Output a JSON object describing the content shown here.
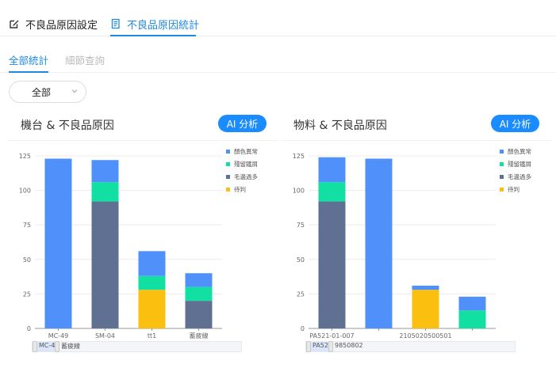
{
  "top_tabs": [
    {
      "label": "不良品原因設定",
      "icon": "edit-icon",
      "active": false
    },
    {
      "label": "不良品原因統計",
      "icon": "document-icon",
      "active": true
    }
  ],
  "sub_tabs": [
    {
      "label": "全部統計",
      "active": true
    },
    {
      "label": "細節查詢",
      "active": false
    }
  ],
  "filter": {
    "selected": "全部"
  },
  "panels": [
    {
      "title": "機台 & 不良品原因",
      "ai_button": "AI 分析",
      "slider": {
        "left_label": "MC-4",
        "right_label": "蓄疲線"
      }
    },
    {
      "title": "物料 & 不良品原因",
      "ai_button": "AI 分析",
      "slider": {
        "left_label": "PA52",
        "right_label": "9850802"
      }
    }
  ],
  "colors": {
    "accent": "#1e88e5",
    "ai_button": "#1a8cff"
  },
  "chart_data": [
    {
      "type": "bar",
      "stacked": true,
      "categories": [
        "MC-49",
        "SM-04",
        "tt1",
        "蓄疲線"
      ],
      "series": [
        {
          "name": "毛邊過多",
          "color": "#5f7093",
          "values": [
            0,
            92,
            0,
            20
          ]
        },
        {
          "name": "待判",
          "color": "#fbbf0f",
          "values": [
            0,
            0,
            28,
            0
          ]
        },
        {
          "name": "殘留鐵屑",
          "color": "#12e0a3",
          "values": [
            0,
            14,
            10,
            10
          ]
        },
        {
          "name": "顏色異常",
          "color": "#5090fa",
          "values": [
            123,
            16,
            18,
            10
          ]
        }
      ],
      "legend": [
        "顏色異常",
        "殘留鐵屑",
        "毛邊過多",
        "待判"
      ],
      "yticks": [
        0,
        25,
        50,
        75,
        100,
        125
      ],
      "ylim": [
        0,
        125
      ],
      "legend_position": "top-right"
    },
    {
      "type": "bar",
      "stacked": true,
      "categories": [
        "PA521-01-007",
        "",
        "2105020500501",
        ""
      ],
      "series": [
        {
          "name": "毛邊過多",
          "color": "#5f7093",
          "values": [
            92,
            0,
            0,
            0
          ]
        },
        {
          "name": "待判",
          "color": "#fbbf0f",
          "values": [
            0,
            0,
            28,
            0
          ]
        },
        {
          "name": "殘留鐵屑",
          "color": "#12e0a3",
          "values": [
            14,
            0,
            0,
            13
          ]
        },
        {
          "name": "顏色異常",
          "color": "#5090fa",
          "values": [
            18,
            123,
            3,
            10
          ]
        }
      ],
      "legend": [
        "顏色異常",
        "殘留鐵屑",
        "毛邊過多",
        "待判"
      ],
      "yticks": [
        0,
        25,
        50,
        75,
        100,
        125
      ],
      "ylim": [
        0,
        125
      ],
      "legend_position": "top-right"
    }
  ]
}
